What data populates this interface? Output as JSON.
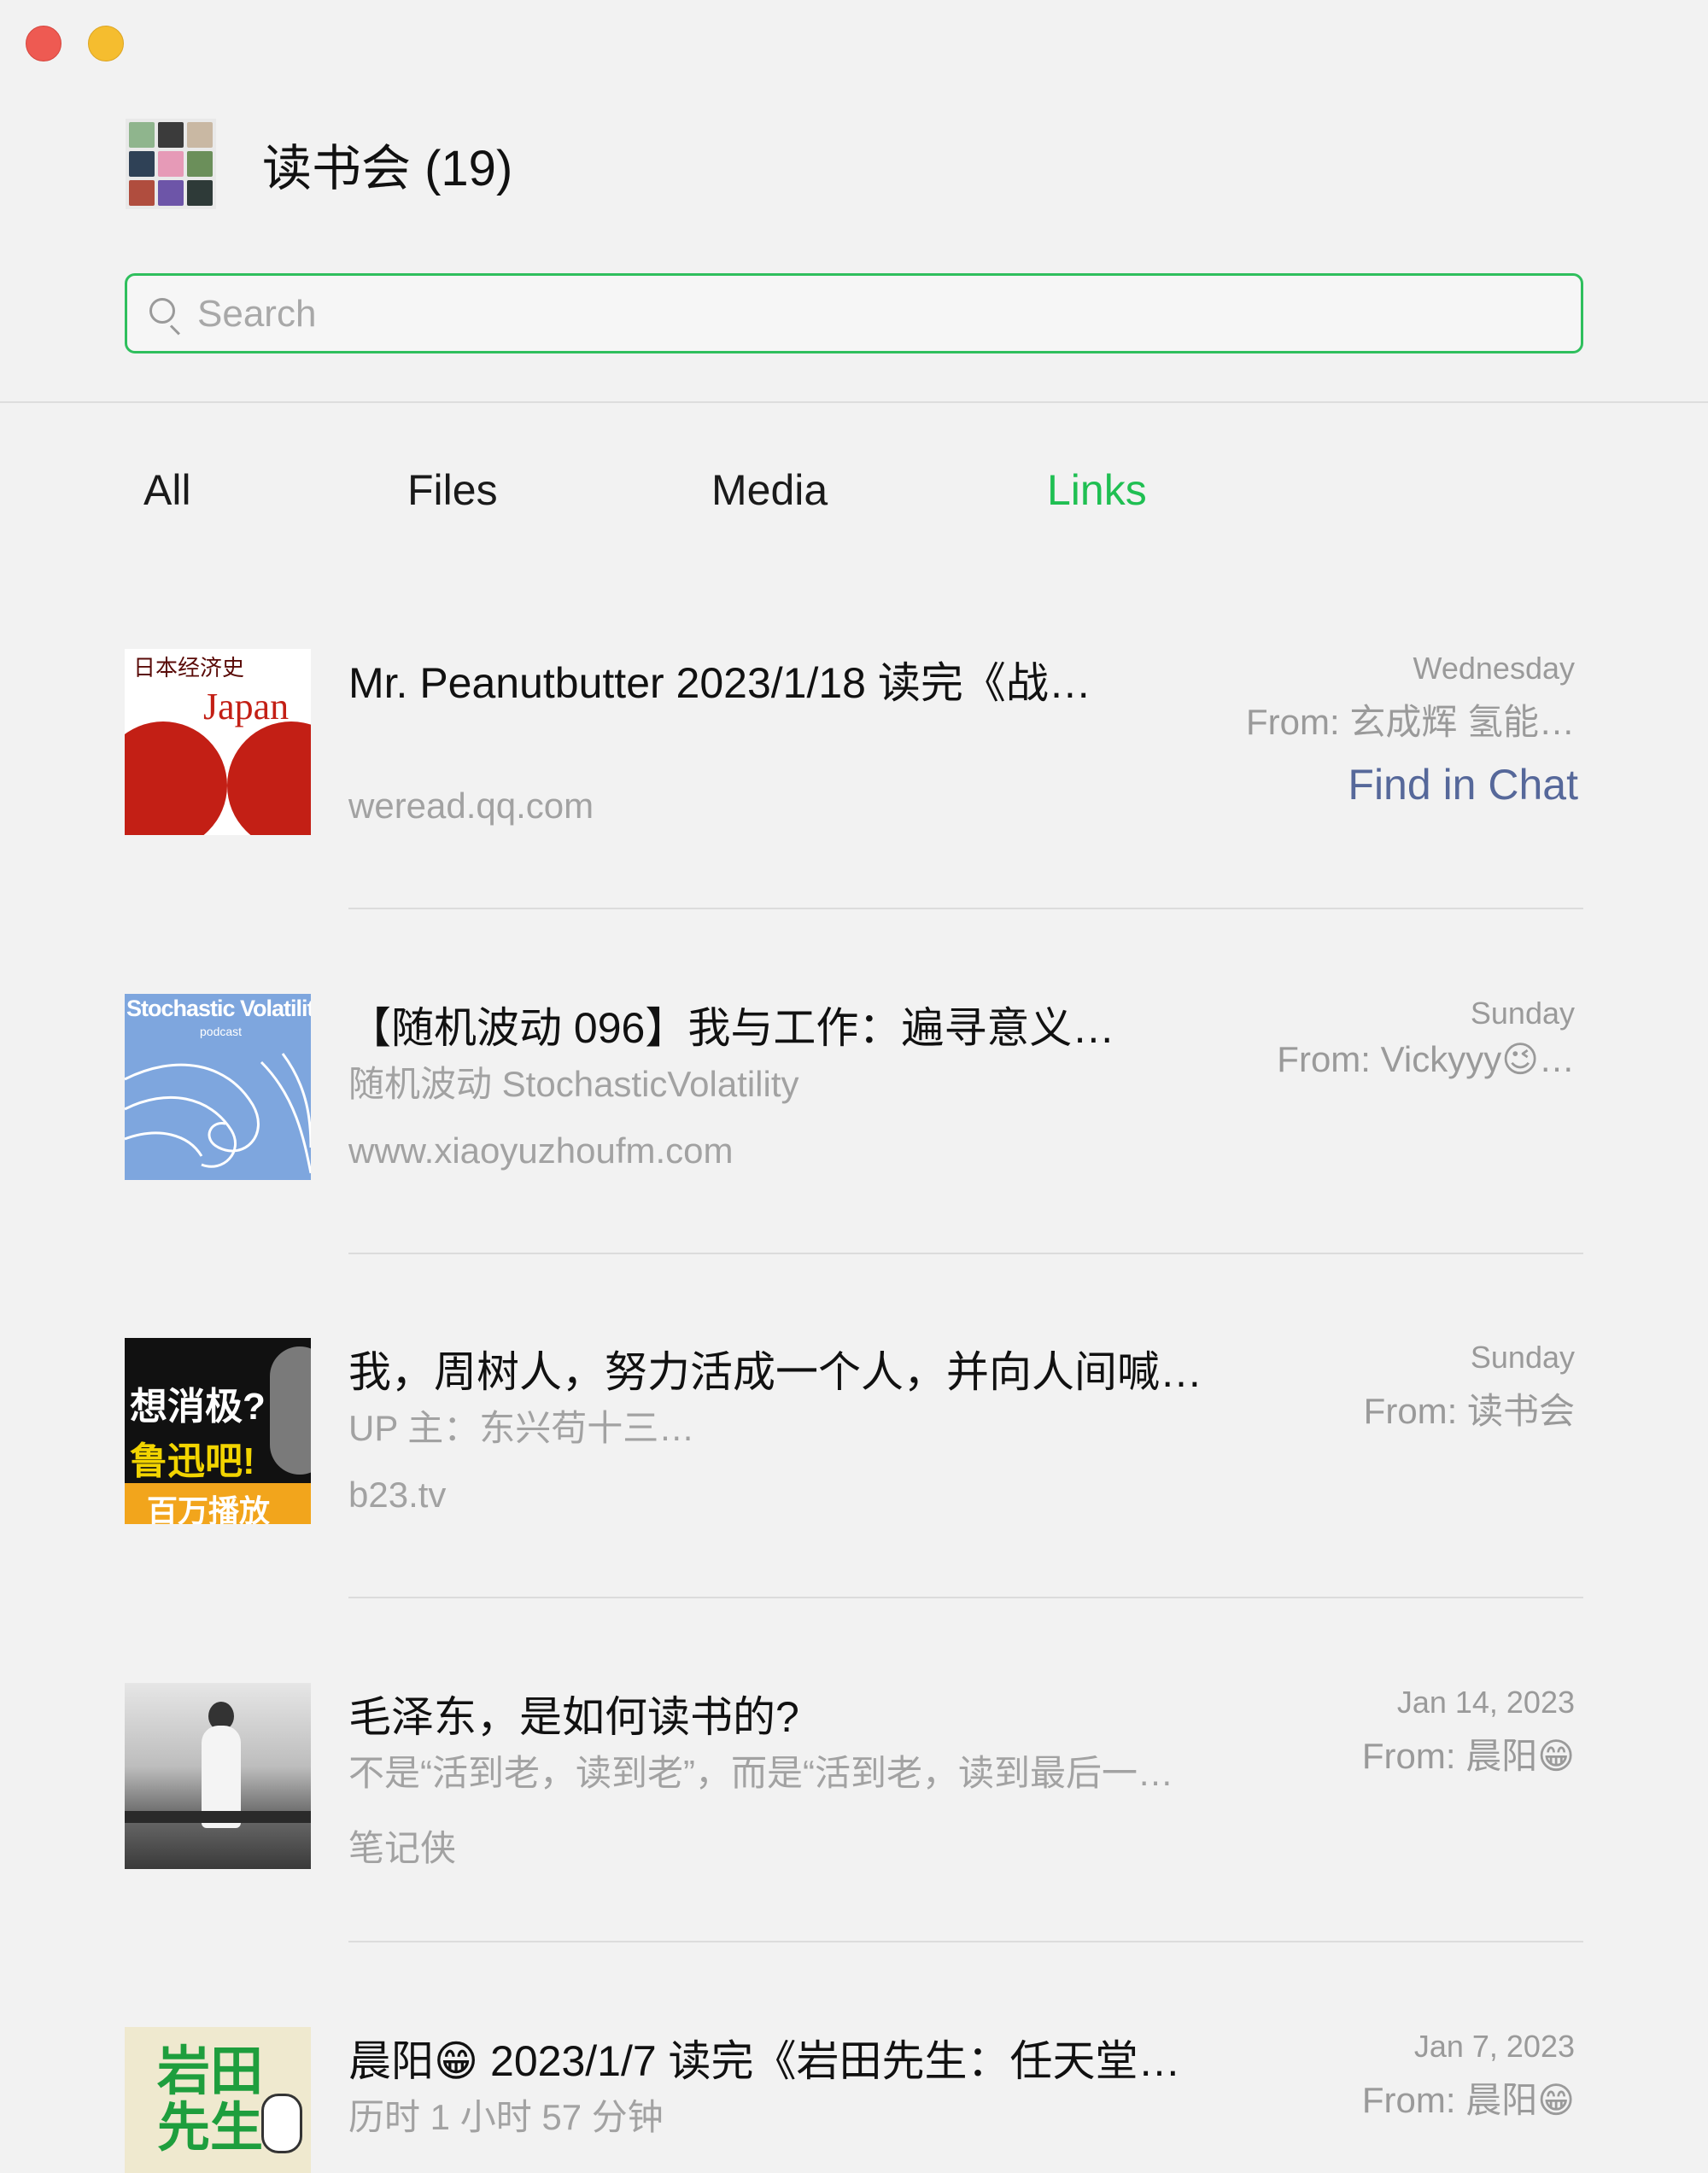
{
  "window": {
    "controls": [
      "close-button",
      "minimize-button"
    ]
  },
  "header": {
    "title": "读书会 (19)",
    "avatar_colors": [
      "#8fb58d",
      "#3b3b3b",
      "#c9b8a3",
      "#2f4156",
      "#e69ab7",
      "#6b8f5a",
      "#b04d3e",
      "#6d55a8",
      "#2e3a38"
    ]
  },
  "search": {
    "placeholder": "Search",
    "value": "",
    "icon": "search-icon",
    "accent": "#2fbf5d"
  },
  "tabs": [
    {
      "label": "All",
      "active": false
    },
    {
      "label": "Files",
      "active": false
    },
    {
      "label": "Media",
      "active": false
    },
    {
      "label": "Links",
      "active": true
    }
  ],
  "colors": {
    "active_tab": "#1fbf52",
    "link_action": "#56689a",
    "muted_text": "#a2a2a2"
  },
  "links": [
    {
      "title": "Mr. Peanutbutter 2023/1/18 读完《战…",
      "subtitle": "",
      "source": "weread.qq.com",
      "date": "Wednesday",
      "from": "From: 玄成辉 氢能…",
      "action": "Find in Chat",
      "thumb_text": "日本经济史",
      "thumb_sub": "Japan"
    },
    {
      "title": "【随机波动 096】我与工作：遍寻意义…",
      "subtitle": "随机波动 StochasticVolatility",
      "source": "www.xiaoyuzhoufm.com",
      "date": "Sunday",
      "from": "From: Vickyyy😉…",
      "action": "",
      "thumb_text": "Stochastic Volatility",
      "thumb_sub": "podcast"
    },
    {
      "title": "我，周树人，努力活成一个人，并向人间喊…",
      "subtitle": "UP 主：东兴苟十三…",
      "source": "b23.tv",
      "date": "Sunday",
      "from": "From: 读书会",
      "action": "",
      "thumb_text": "想消极?",
      "thumb_sub": "鲁迅吧!",
      "thumb_extra": "百万播放"
    },
    {
      "title": "毛泽东，是如何读书的?",
      "subtitle": "不是“活到老，读到老”，而是“活到老，读到最后一…",
      "source": "笔记侠",
      "date": "Jan 14, 2023",
      "from": "From: 晨阳😁",
      "action": ""
    },
    {
      "title": "晨阳😁 2023/1/7 读完《岩田先生：任天堂…",
      "subtitle": "历时 1 小时 57 分钟",
      "source": "",
      "date": "Jan 7, 2023",
      "from": "From: 晨阳😁",
      "action": "",
      "thumb_text": "岩田先生"
    }
  ]
}
